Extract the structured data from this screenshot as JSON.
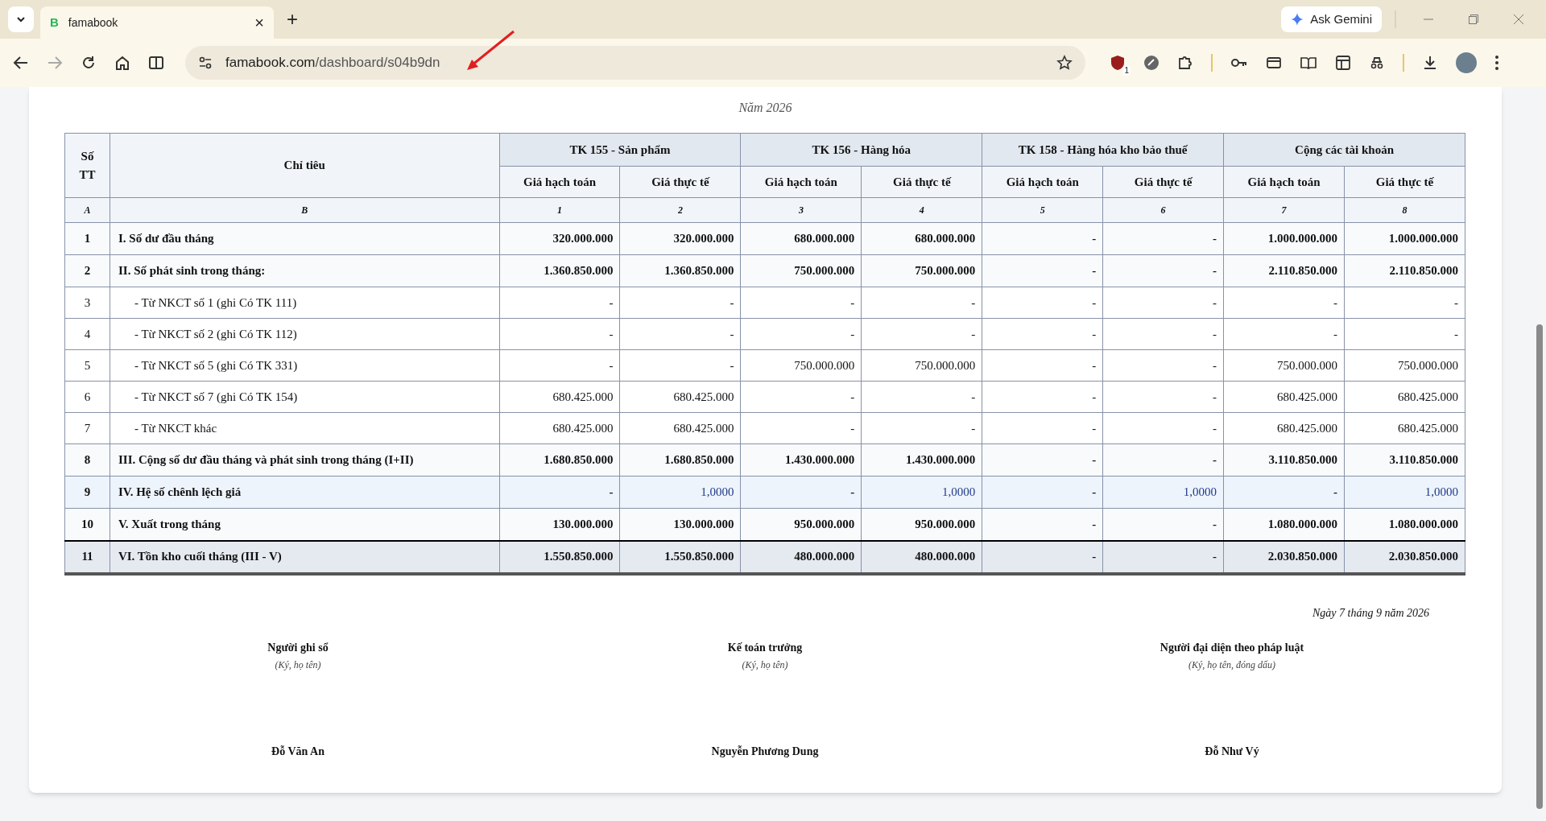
{
  "browser": {
    "tab": {
      "favicon": "B",
      "title": "famabook",
      "close": "×"
    },
    "new_tab": "+",
    "ask_gemini": "Ask Gemini",
    "url": {
      "domain": "famabook.com",
      "path": "/dashboard/s04b9dn"
    },
    "extension_badge": "1"
  },
  "report": {
    "year": "Năm 2026",
    "header": {
      "stt": "Số TT",
      "indicator": "Chỉ tiêu",
      "groups": [
        {
          "title": "TK 155 - Sản phẩm",
          "subcolumns": [
            "Giá hạch toán",
            "Giá thực tế"
          ]
        },
        {
          "title": "TK 156 - Hàng hóa",
          "subcolumns": [
            "Giá hạch toán",
            "Giá thực tế"
          ]
        },
        {
          "title": "TK 158 - Hàng hóa kho bảo thuế",
          "subcolumns": [
            "Giá hạch toán",
            "Giá thực tế"
          ]
        },
        {
          "title": "Cộng các tài khoản",
          "subcolumns": [
            "Giá hạch toán",
            "Giá thực tế"
          ]
        }
      ],
      "codes": [
        "A",
        "B",
        "1",
        "2",
        "3",
        "4",
        "5",
        "6",
        "7",
        "8"
      ]
    },
    "rows": [
      {
        "kind": "section",
        "no": "1",
        "label": "I. Số dư đầu tháng",
        "values": [
          "320.000.000",
          "320.000.000",
          "680.000.000",
          "680.000.000",
          "-",
          "-",
          "1.000.000.000",
          "1.000.000.000"
        ]
      },
      {
        "kind": "section",
        "no": "2",
        "label": "II. Số phát sinh trong tháng:",
        "values": [
          "1.360.850.000",
          "1.360.850.000",
          "750.000.000",
          "750.000.000",
          "-",
          "-",
          "2.110.850.000",
          "2.110.850.000"
        ]
      },
      {
        "kind": "detail",
        "no": "3",
        "label": "- Từ NKCT số 1 (ghi Có TK 111)",
        "values": [
          "-",
          "-",
          "-",
          "-",
          "-",
          "-",
          "-",
          "-"
        ]
      },
      {
        "kind": "detail",
        "no": "4",
        "label": "- Từ NKCT số 2 (ghi Có TK 112)",
        "values": [
          "-",
          "-",
          "-",
          "-",
          "-",
          "-",
          "-",
          "-"
        ]
      },
      {
        "kind": "detail",
        "no": "5",
        "label": "- Từ NKCT số 5 (ghi Có TK 331)",
        "values": [
          "-",
          "-",
          "750.000.000",
          "750.000.000",
          "-",
          "-",
          "750.000.000",
          "750.000.000"
        ]
      },
      {
        "kind": "detail",
        "no": "6",
        "label": "- Từ NKCT số 7 (ghi Có TK 154)",
        "values": [
          "680.425.000",
          "680.425.000",
          "-",
          "-",
          "-",
          "-",
          "680.425.000",
          "680.425.000"
        ]
      },
      {
        "kind": "detail",
        "no": "7",
        "label": "- Từ NKCT khác",
        "values": [
          "680.425.000",
          "680.425.000",
          "-",
          "-",
          "-",
          "-",
          "680.425.000",
          "680.425.000"
        ]
      },
      {
        "kind": "section",
        "no": "8",
        "label": "III. Cộng số dư đầu tháng và phát sinh trong tháng (I+II)",
        "values": [
          "1.680.850.000",
          "1.680.850.000",
          "1.430.000.000",
          "1.430.000.000",
          "-",
          "-",
          "3.110.850.000",
          "3.110.850.000"
        ]
      },
      {
        "kind": "ratio",
        "no": "9",
        "label": "IV. Hệ số chênh lệch giá",
        "values": [
          "-",
          "1,0000",
          "-",
          "1,0000",
          "-",
          "1,0000",
          "-",
          "1,0000"
        ],
        "highlighted_cells": [
          false,
          true,
          false,
          true,
          false,
          true,
          false,
          true
        ]
      },
      {
        "kind": "section",
        "no": "10",
        "label": "V. Xuất trong tháng",
        "values": [
          "130.000.000",
          "130.000.000",
          "950.000.000",
          "950.000.000",
          "-",
          "-",
          "1.080.000.000",
          "1.080.000.000"
        ]
      },
      {
        "kind": "total",
        "no": "11",
        "label": "VI. Tồn kho cuối tháng (III - V)",
        "values": [
          "1.550.850.000",
          "1.550.850.000",
          "480.000.000",
          "480.000.000",
          "-",
          "-",
          "2.030.850.000",
          "2.030.850.000"
        ]
      }
    ],
    "date": "Ngày 7 tháng 9 năm 2026",
    "signatures": [
      {
        "role": "Người ghi sổ",
        "note": "(Ký, họ tên)",
        "name": "Đỗ Văn An"
      },
      {
        "role": "Kế toán trưởng",
        "note": "(Ký, họ tên)",
        "name": "Nguyễn Phương Dung"
      },
      {
        "role": "Người đại diện theo pháp luật",
        "note": "(Ký, họ tên, đóng dấu)",
        "name": "Đỗ Như Vý"
      }
    ]
  }
}
